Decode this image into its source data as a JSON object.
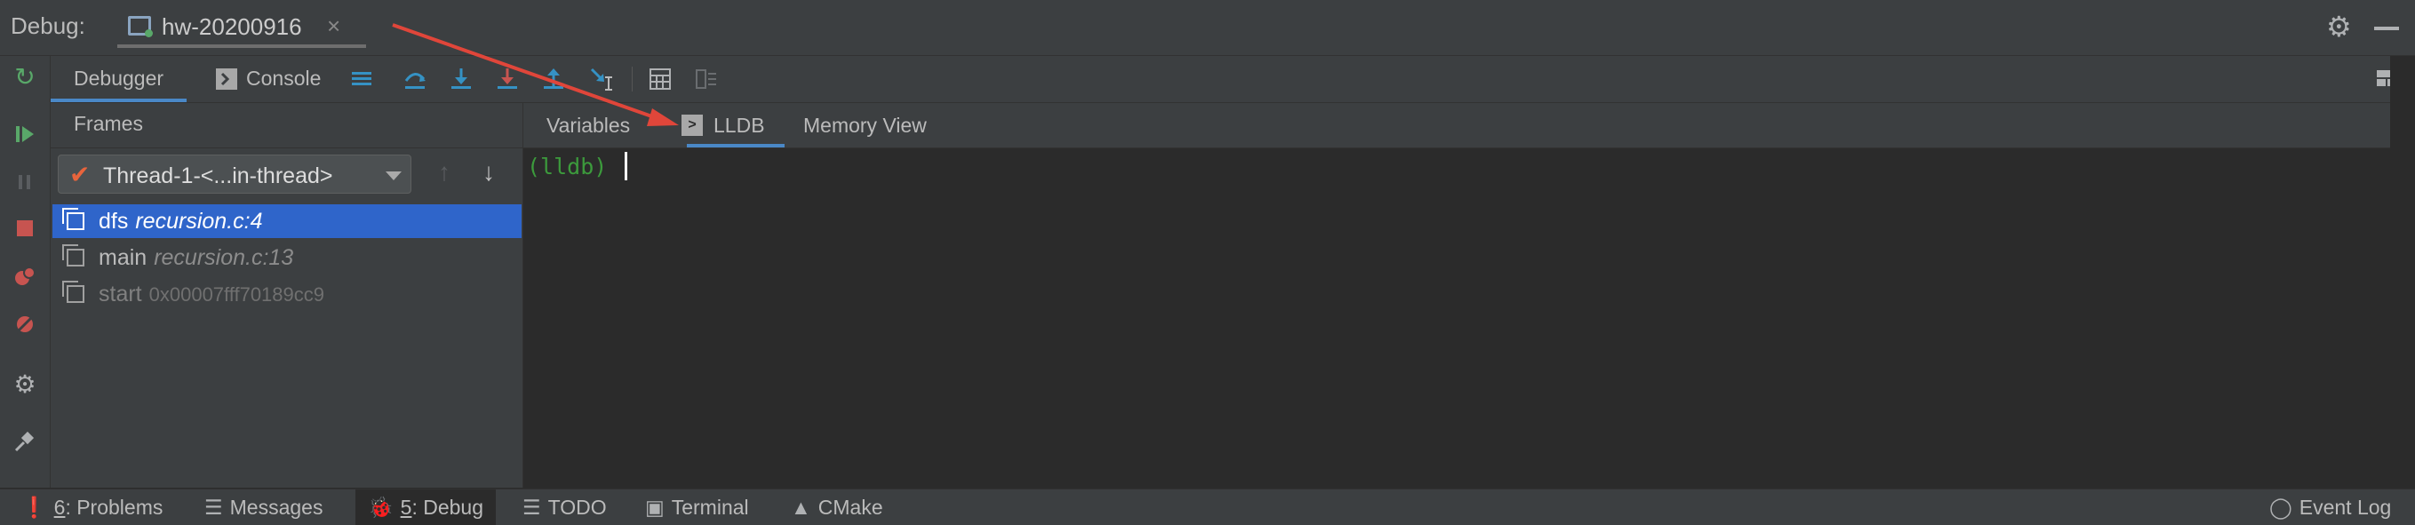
{
  "titlebar": {
    "debug_label": "Debug:",
    "run_tab_name": "hw-20200916",
    "close_glyph": "×"
  },
  "toolbar": {
    "debugger_tab": "Debugger",
    "console_tab": "Console"
  },
  "frames": {
    "title": "Frames",
    "thread": "Thread-1-<...in-thread>",
    "rows": [
      {
        "fn": "dfs",
        "loc": "recursion.c:4"
      },
      {
        "fn": "main",
        "loc": "recursion.c:13"
      },
      {
        "fn": "start",
        "loc": "0x00007fff70189cc9"
      }
    ]
  },
  "tabs": {
    "variables": "Variables",
    "lldb": "LLDB",
    "memory_view": "Memory View"
  },
  "console": {
    "prompt": "(lldb)"
  },
  "statusbar": {
    "problems_num": "6",
    "problems": ": Problems",
    "messages": "Messages",
    "debug_num": "5",
    "debug": ": Debug",
    "todo": "TODO",
    "terminal": "Terminal",
    "cmake": "CMake",
    "event_log": "Event Log"
  },
  "colors": {
    "accent": "#4a88c7",
    "selection": "#2f65ca",
    "annotation_arrow": "#e0463a",
    "prompt": "#3c9a3c"
  }
}
